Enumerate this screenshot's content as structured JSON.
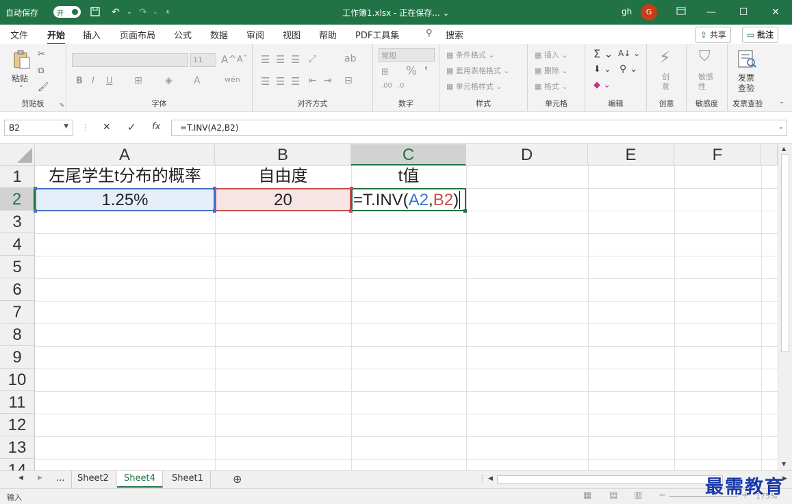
{
  "titlebar": {
    "autosave_label": "自动保存",
    "autosave_state": "开",
    "title": "工作簿1.xlsx - 正在保存... ⌄",
    "user": "gh",
    "avatar_letter": "G",
    "accent": "#217346"
  },
  "ribbon_tabs": [
    "文件",
    "开始",
    "插入",
    "页面布局",
    "公式",
    "数据",
    "审阅",
    "视图",
    "帮助",
    "PDF工具集",
    "搜索"
  ],
  "share_label": "共享",
  "comment_label": "批注",
  "ribbon": {
    "clipboard": {
      "paste": "粘贴",
      "name": "剪贴板"
    },
    "font": {
      "name": "字体",
      "size": "11",
      "bold": "B",
      "italic": "I",
      "underline": "U"
    },
    "align": {
      "name": "对齐方式"
    },
    "number": {
      "name": "数字",
      "format": "常规"
    },
    "styles": {
      "name": "样式",
      "cond": "条件格式",
      "table": "套用表格格式",
      "cell": "单元格样式"
    },
    "cells": {
      "name": "单元格",
      "insert": "插入",
      "delete": "删除",
      "format": "格式"
    },
    "edit": {
      "name": "编辑"
    },
    "ideas": {
      "name": "创意",
      "btn": "创意"
    },
    "sens": {
      "name": "敏感度",
      "btn": "敏感性"
    },
    "invoice": {
      "name": "发票查验",
      "btn1": "发票",
      "btn2": "查验"
    }
  },
  "formula_bar": {
    "name_box": "B2",
    "formula": "=T.INV(A2,B2)"
  },
  "columns": [
    "A",
    "B",
    "C",
    "D",
    "E",
    "F"
  ],
  "rows": [
    "1",
    "2",
    "3",
    "4",
    "5",
    "6",
    "7",
    "8",
    "9",
    "10",
    "11",
    "12",
    "13",
    "14"
  ],
  "cells": {
    "A1": "左尾学生t分布的概率",
    "B1": "自由度",
    "C1": "t值",
    "A2": "1.25%",
    "B2": "20",
    "C2_prefix": "=T.INV(",
    "C2_ref1": "A2",
    "C2_sep": ",",
    "C2_ref2": "B2",
    "C2_suffix": ")"
  },
  "ref_colors": {
    "a2": "#4472c4",
    "b2": "#c0504d"
  },
  "sheets": [
    "Sheet2",
    "Sheet4",
    "Sheet1"
  ],
  "active_sheet": "Sheet4",
  "ellipsis": "...",
  "status": {
    "mode": "输入",
    "zoom": "175%"
  },
  "watermark": "最需教育"
}
